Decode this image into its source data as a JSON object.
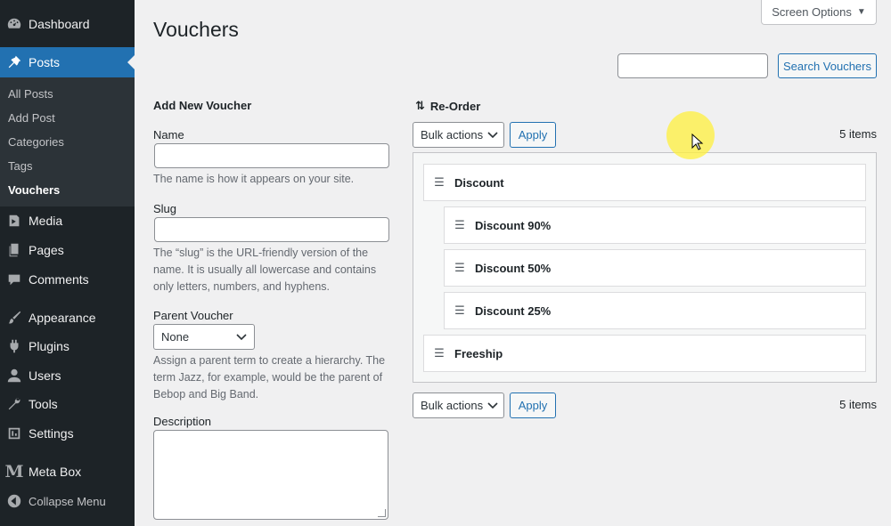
{
  "sidebar": {
    "items": [
      {
        "label": "Dashboard",
        "icon": "dashboard-icon"
      },
      {
        "label": "Posts",
        "icon": "pushpin-icon",
        "active": true
      },
      {
        "label": "Media",
        "icon": "media-icon"
      },
      {
        "label": "Pages",
        "icon": "pages-icon"
      },
      {
        "label": "Comments",
        "icon": "comments-icon"
      },
      {
        "label": "Appearance",
        "icon": "paintbrush-icon"
      },
      {
        "label": "Plugins",
        "icon": "plugin-icon"
      },
      {
        "label": "Users",
        "icon": "users-icon"
      },
      {
        "label": "Tools",
        "icon": "wrench-icon"
      },
      {
        "label": "Settings",
        "icon": "settings-icon"
      },
      {
        "label": "Meta Box",
        "icon": "metabox-m-icon"
      }
    ],
    "submenu": [
      "All Posts",
      "Add Post",
      "Categories",
      "Tags",
      "Vouchers"
    ],
    "collapse_label": "Collapse Menu"
  },
  "header": {
    "title": "Vouchers",
    "screen_options": "Screen Options",
    "search_button": "Search Vouchers",
    "search_value": ""
  },
  "form": {
    "heading": "Add New Voucher",
    "name_label": "Name",
    "name_help": "The name is how it appears on your site.",
    "slug_label": "Slug",
    "slug_help": "The “slug” is the URL-friendly version of the name. It is usually all lowercase and contains only letters, numbers, and hyphens.",
    "parent_label": "Parent Voucher",
    "parent_value": "None",
    "parent_help": "Assign a parent term to create a hierarchy. The term Jazz, for example, would be the parent of Bebop and Big Band.",
    "description_label": "Description"
  },
  "list": {
    "reorder_label": "Re-Order",
    "bulk_actions": "Bulk actions",
    "apply_label": "Apply",
    "count_label": "5 items",
    "rows": [
      "Discount",
      "Discount 90%",
      "Discount 50%",
      "Discount 25%",
      "Freeship"
    ]
  },
  "colors": {
    "sidebar_bg": "#1d2327",
    "accent": "#2271b1",
    "page_bg": "#f0f0f1"
  }
}
